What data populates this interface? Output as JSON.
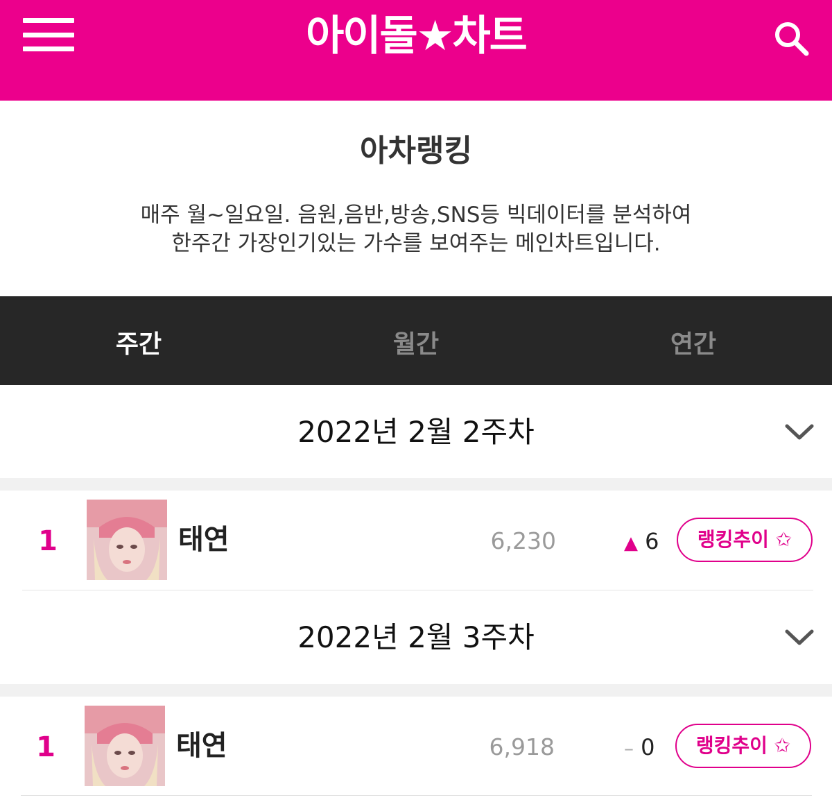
{
  "header": {
    "logo": "아이돌★차트",
    "menu_icon": "hamburger-menu-icon",
    "search_icon": "search-icon",
    "brand_color": "#ec008c"
  },
  "page": {
    "title": "아차랭킹",
    "desc_line1": "매주 월~일요일. 음원,음반,방송,SNS등 빅데이터를 분석하여",
    "desc_line2": "한주간 가장인기있는 가수를 보여주는 메인차트입니다."
  },
  "tabs": [
    {
      "label": "주간",
      "active": true
    },
    {
      "label": "월간",
      "active": false
    },
    {
      "label": "연간",
      "active": false
    }
  ],
  "weeks": [
    {
      "label": "2022년 2월 2주차",
      "entry": {
        "rank": "1",
        "artist": "태연",
        "score": "6,230",
        "change_symbol": "▲",
        "change_value": "6",
        "change_type": "up",
        "button_label": "랭킹추이 ✩"
      }
    },
    {
      "label": "2022년 2월 3주차",
      "entry": {
        "rank": "1",
        "artist": "태연",
        "score": "6,918",
        "change_symbol": "–",
        "change_value": "0",
        "change_type": "same",
        "button_label": "랭킹추이 ✩"
      }
    }
  ]
}
